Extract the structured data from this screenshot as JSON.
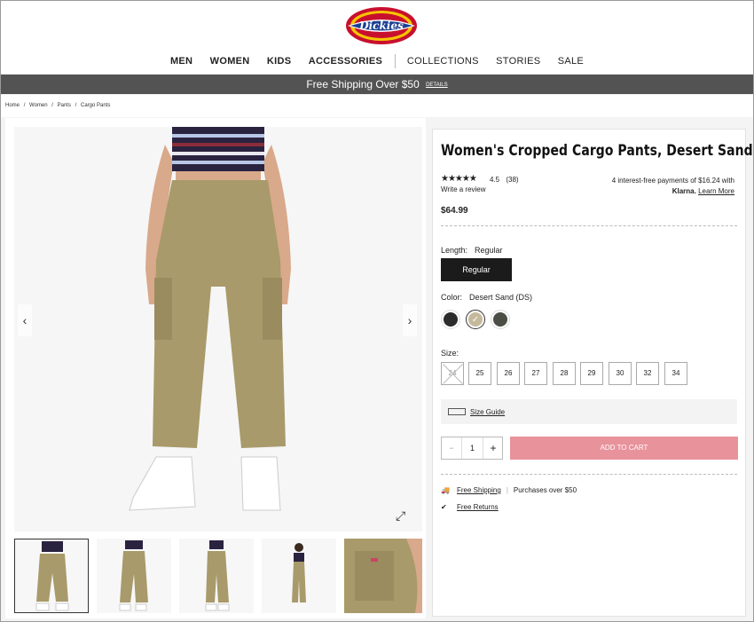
{
  "header": {
    "logo_text": "Dickies",
    "nav": [
      "MEN",
      "WOMEN",
      "KIDS",
      "ACCESSORIES",
      "COLLECTIONS",
      "STORIES",
      "SALE"
    ]
  },
  "promo": {
    "text": "Free Shipping Over $50",
    "link": "DETAILS"
  },
  "breadcrumb": [
    "Home",
    "/",
    "Women",
    "/",
    "Pants",
    "/",
    "Cargo Pants"
  ],
  "product": {
    "title": "Women's Cropped Cargo Pants, Desert Sand",
    "stars": "★★★★★",
    "rating": "4.5",
    "review_count": "(38)",
    "write_review": "Write a review",
    "klarna_line1": "4 interest-free payments of $16.24 with",
    "klarna_brand": "Klarna.",
    "klarna_link": "Learn More",
    "price": "$64.99",
    "length_label": "Length:",
    "length_value": "Regular",
    "length_button": "Regular",
    "color_label": "Color:",
    "color_value": "Desert Sand (DS)",
    "swatches": [
      "#2b2b2b",
      "#c4b99a",
      "#4b4e45"
    ],
    "size_label": "Size:",
    "sizes": [
      "24",
      "25",
      "26",
      "27",
      "28",
      "29",
      "30",
      "32",
      "34"
    ],
    "size_guide": "Size Guide",
    "qty": "1",
    "qty_minus": "−",
    "qty_plus": "+",
    "add_to_cart": "ADD TO CART",
    "free_shipping": "Free Shipping",
    "purchases_over": "Purchases over $50",
    "free_returns": "Free Returns"
  },
  "colors": {
    "accent": "#e8929b",
    "dark": "#1b1b1b",
    "promo_bg": "#535353"
  },
  "icons": {
    "prev": "chevron-left-icon",
    "next": "chevron-right-icon",
    "expand": "expand-icon",
    "truck": "truck-icon",
    "check": "check-circle-icon",
    "ruler": "ruler-icon"
  }
}
